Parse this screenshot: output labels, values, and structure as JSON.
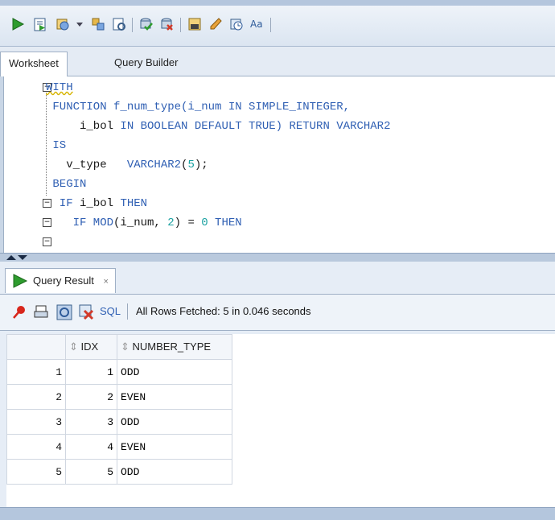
{
  "colors": {
    "keyword": "#2f5fb3",
    "number": "#19a0a0",
    "accent": "#c9d6e6"
  },
  "toolbar": {
    "icons": [
      "run-statement-icon",
      "run-script-icon",
      "autotrace-icon",
      "dropdown-icon",
      "explain-plan-icon",
      "sql-tuning-icon",
      "commit-icon",
      "rollback-icon",
      "sql-worksheet-icon",
      "clear-icon",
      "history-icon",
      "format-case-icon"
    ]
  },
  "tabs": {
    "worksheet": "Worksheet",
    "query_builder": "Query Builder"
  },
  "code": {
    "l1": "WITH",
    "l2a": " FUNCTION f_num_type(i_num ",
    "l2b": "IN SIMPLE_INTEGER,",
    "l3a": "     i_bol ",
    "l3b": "IN BOOLEAN DEFAULT TRUE) RETURN VARCHAR2",
    "l4": " IS",
    "l5a": "   v_type   ",
    "l5b": "VARCHAR2",
    "l5c": "(",
    "l5d": "5",
    "l5e": ");",
    "l6": " BEGIN",
    "l7a": "  IF ",
    "l7b": "i_bol ",
    "l7c": "THEN",
    "l8a": "    IF MOD",
    "l8b": "(i_num, ",
    "l8c": "2",
    "l8d": ") = ",
    "l8e": "0",
    "l8f": " THEN"
  },
  "results": {
    "tab_label": "Query Result",
    "close": "×",
    "sql_link": "SQL",
    "status": "All Rows Fetched: 5 in 0.046 seconds",
    "columns": [
      "IDX",
      "NUMBER_TYPE"
    ],
    "rows": [
      {
        "n": "1",
        "idx": "1",
        "type": "ODD"
      },
      {
        "n": "2",
        "idx": "2",
        "type": "EVEN"
      },
      {
        "n": "3",
        "idx": "3",
        "type": "ODD"
      },
      {
        "n": "4",
        "idx": "4",
        "type": "EVEN"
      },
      {
        "n": "5",
        "idx": "5",
        "type": "ODD"
      }
    ]
  }
}
